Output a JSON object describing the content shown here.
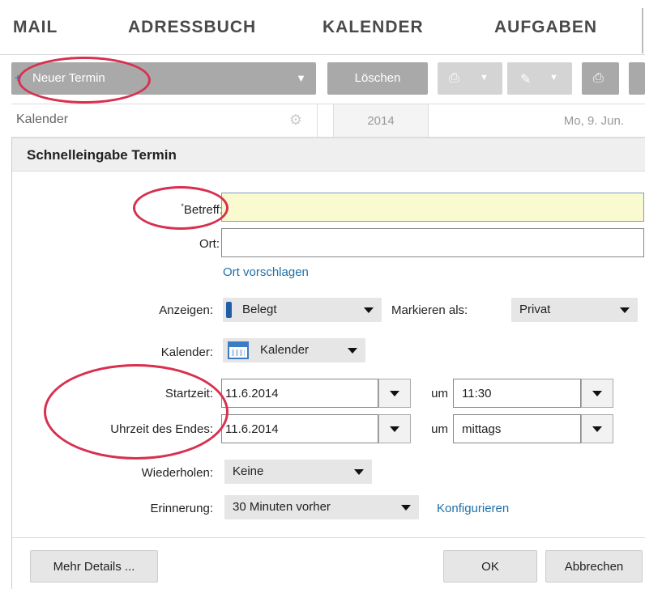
{
  "nav": {
    "items": [
      "MAIL",
      "ADRESSBUCH",
      "KALENDER",
      "AUFGABEN"
    ]
  },
  "toolbar": {
    "new_label": "Neuer Termin",
    "delete_label": "Löschen"
  },
  "calendar_bar": {
    "calendar_label": "Kalender",
    "year": "2014",
    "date": "Mo, 9. Jun."
  },
  "dialog": {
    "title": "Schnelleingabe Termin",
    "required_mark": "*",
    "subject_label": "Betreff:",
    "subject_value": "",
    "location_label": "Ort:",
    "location_value": "",
    "suggest_location": "Ort vorschlagen",
    "show_label": "Anzeigen:",
    "show_value": "Belegt",
    "mark_label": "Markieren als:",
    "mark_value": "Privat",
    "calendar_label": "Kalender:",
    "calendar_value": "Kalender",
    "start_label": "Startzeit:",
    "start_date": "11.6.2014",
    "start_um": "um",
    "start_time": "11:30",
    "end_label": "Uhrzeit des Endes:",
    "end_date": "11.6.2014",
    "end_um": "um",
    "end_time": "mittags",
    "repeat_label": "Wiederholen:",
    "repeat_value": "Keine",
    "reminder_label": "Erinnerung:",
    "reminder_value": "30 Minuten vorher",
    "configure": "Konfigurieren",
    "more_details": "Mehr Details ...",
    "ok": "OK",
    "cancel": "Abbrechen"
  },
  "colors": {
    "annotation": "#d8304f",
    "link": "#1e6fa8",
    "required_bg": "#fafad0"
  }
}
